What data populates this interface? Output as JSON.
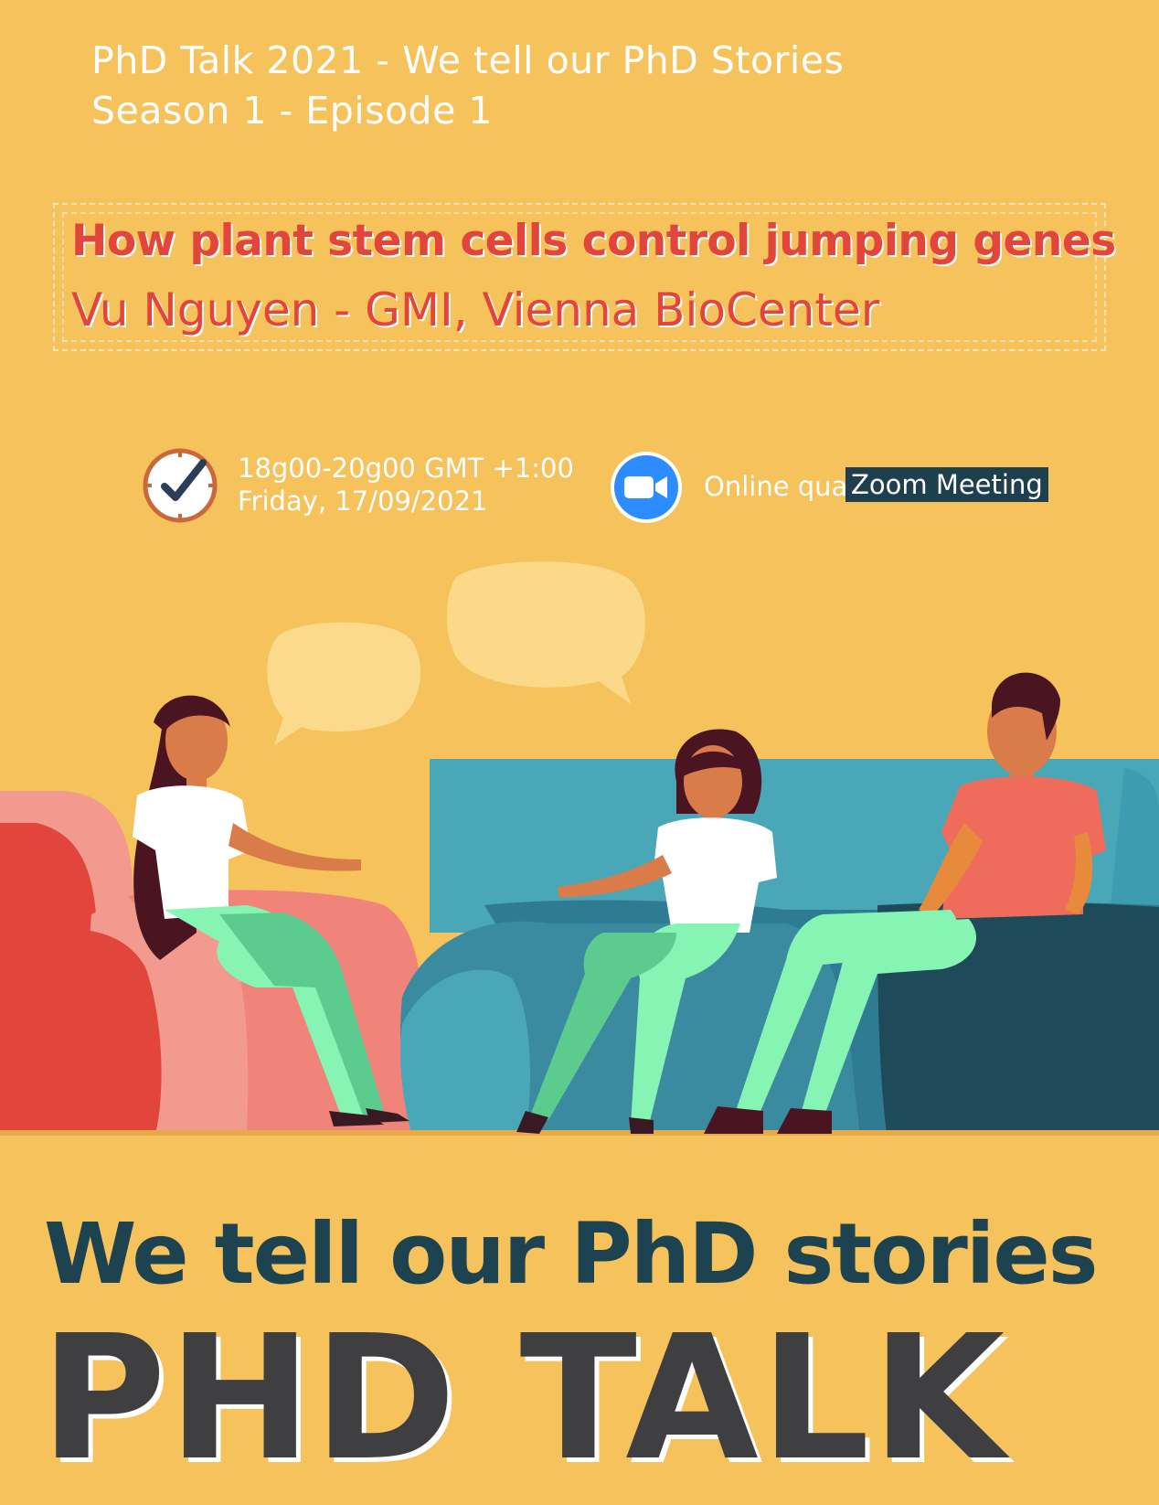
{
  "header": {
    "line1": "PhD Talk 2021 - We tell our PhD Stories",
    "line2": "Season 1 - Episode 1"
  },
  "talk": {
    "title": "How plant stem cells control jumping genes",
    "speaker": "Vu Nguyen - GMI, Vienna BioCenter"
  },
  "schedule": {
    "time": "18g00-20g00 GMT +1:00",
    "date": "Friday, 17/09/2021"
  },
  "venue": {
    "prefix": "Online qua",
    "platform": "Zoom Meeting"
  },
  "footer": {
    "tagline": "We tell our PhD stories",
    "brand": "PHD TALK"
  },
  "icons": [
    "clock-check-icon",
    "zoom-camera-icon"
  ],
  "colors": {
    "background": "#f5c25c",
    "title_red": "#e2453b",
    "tagline_teal": "#1e4350",
    "brand_gray": "#3f3f41"
  }
}
